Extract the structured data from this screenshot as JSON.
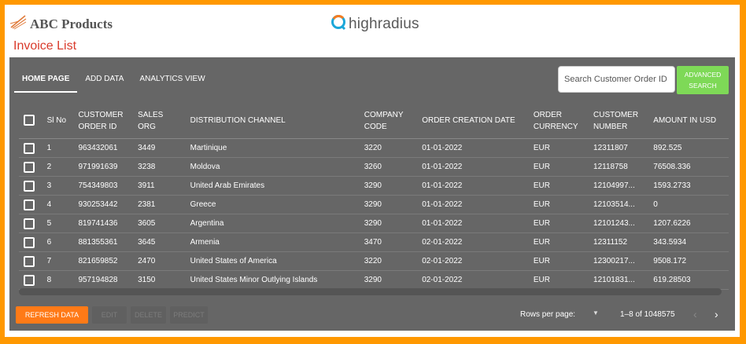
{
  "brand": {
    "name": "ABC Products"
  },
  "logo": {
    "text": "highradius"
  },
  "page": {
    "title": "Invoice List"
  },
  "tabs": [
    {
      "label": "HOME PAGE",
      "active": true
    },
    {
      "label": "ADD DATA",
      "active": false
    },
    {
      "label": "ANALYTICS VIEW",
      "active": false
    }
  ],
  "search": {
    "placeholder": "Search Customer Order ID",
    "value": ""
  },
  "advanced_search": {
    "line1": "ADVANCED",
    "line2": "SEARCH"
  },
  "table": {
    "columns": [
      {
        "line1": "Sl No",
        "line2": ""
      },
      {
        "line1": "CUSTOMER",
        "line2": "ORDER ID"
      },
      {
        "line1": "SALES",
        "line2": "ORG"
      },
      {
        "line1": "DISTRIBUTION CHANNEL",
        "line2": ""
      },
      {
        "line1": "COMPANY",
        "line2": "CODE"
      },
      {
        "line1": "ORDER CREATION DATE",
        "line2": ""
      },
      {
        "line1": "ORDER",
        "line2": "CURRENCY"
      },
      {
        "line1": "CUSTOMER",
        "line2": "NUMBER"
      },
      {
        "line1": "AMOUNT IN USD",
        "line2": ""
      }
    ],
    "rows": [
      [
        "1",
        "963432061",
        "3449",
        "Martinique",
        "3220",
        "01-01-2022",
        "EUR",
        "12311807",
        "892.525"
      ],
      [
        "2",
        "971991639",
        "3238",
        "Moldova",
        "3260",
        "01-01-2022",
        "EUR",
        "12118758",
        "76508.336"
      ],
      [
        "3",
        "754349803",
        "3911",
        "United Arab Emirates",
        "3290",
        "01-01-2022",
        "EUR",
        "12104997...",
        "1593.2733"
      ],
      [
        "4",
        "930253442",
        "2381",
        "Greece",
        "3290",
        "01-01-2022",
        "EUR",
        "12103514...",
        "0"
      ],
      [
        "5",
        "819741436",
        "3605",
        "Argentina",
        "3290",
        "01-01-2022",
        "EUR",
        "12101243...",
        "1207.6226"
      ],
      [
        "6",
        "881355361",
        "3645",
        "Armenia",
        "3470",
        "02-01-2022",
        "EUR",
        "12311152",
        "343.5934"
      ],
      [
        "7",
        "821659852",
        "2470",
        "United States of America",
        "3220",
        "02-01-2022",
        "EUR",
        "12300217...",
        "9508.172"
      ],
      [
        "8",
        "957194828",
        "3150",
        "United States Minor Outlying Islands",
        "3290",
        "02-01-2022",
        "EUR",
        "12101831...",
        "619.28503"
      ]
    ]
  },
  "footer": {
    "refresh_label": "REFRESH DATA",
    "edit_label": "EDIT",
    "delete_label": "DELETE",
    "predict_label": "PREDICT",
    "rows_per_page_label": "Rows per page:",
    "rows_per_page_value": "",
    "range": "1–8 of 1048575"
  },
  "icons": {
    "brand": "wing-logo-icon",
    "logo": "highradius-swirl-icon",
    "dropdown": "caret-down-icon",
    "prev": "chevron-left-icon",
    "next": "chevron-right-icon"
  },
  "colors": {
    "border": "#ff9800",
    "panel": "#666666",
    "accent": "#ff7a17",
    "advanced_button": "#7ed957",
    "title": "#d93a2b"
  }
}
